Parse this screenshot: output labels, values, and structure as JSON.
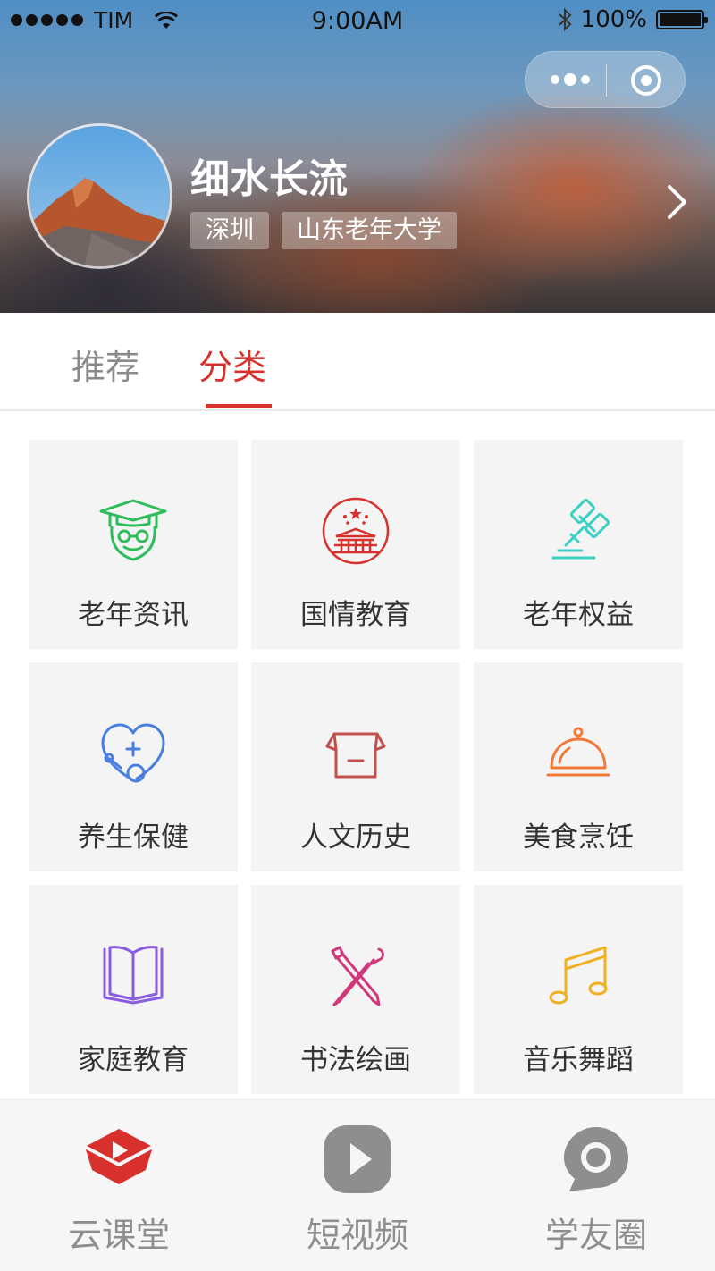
{
  "status_bar": {
    "carrier": "TIM",
    "time": "9:00AM",
    "battery": "100%"
  },
  "profile": {
    "name": "细水长流",
    "tags": [
      "深圳",
      "山东老年大学"
    ]
  },
  "tabs": [
    {
      "label": "推荐",
      "active": false
    },
    {
      "label": "分类",
      "active": true
    }
  ],
  "categories": [
    {
      "label": "老年资讯",
      "icon": "graduate-icon",
      "color": "#2ebd5a"
    },
    {
      "label": "国情教育",
      "icon": "tiananmen-icon",
      "color": "#d8302c"
    },
    {
      "label": "老年权益",
      "icon": "gavel-icon",
      "color": "#3ccfc4"
    },
    {
      "label": "养生保健",
      "icon": "health-heart-icon",
      "color": "#4a7fe0"
    },
    {
      "label": "人文历史",
      "icon": "scroll-icon",
      "color": "#c0504d"
    },
    {
      "label": "美食烹饪",
      "icon": "cloche-icon",
      "color": "#f07a3a"
    },
    {
      "label": "家庭教育",
      "icon": "book-icon",
      "color": "#8a5ce0"
    },
    {
      "label": "书法绘画",
      "icon": "brush-pen-icon",
      "color": "#d0387a"
    },
    {
      "label": "音乐舞蹈",
      "icon": "music-note-icon",
      "color": "#f0b020"
    }
  ],
  "bottom_nav": [
    {
      "label": "云课堂",
      "icon": "cloud-class-icon",
      "active": true
    },
    {
      "label": "短视频",
      "icon": "play-icon",
      "active": false
    },
    {
      "label": "学友圈",
      "icon": "chat-circle-icon",
      "active": false
    }
  ],
  "colors": {
    "accent": "#d8302c",
    "inactive": "#8e8e8e"
  }
}
